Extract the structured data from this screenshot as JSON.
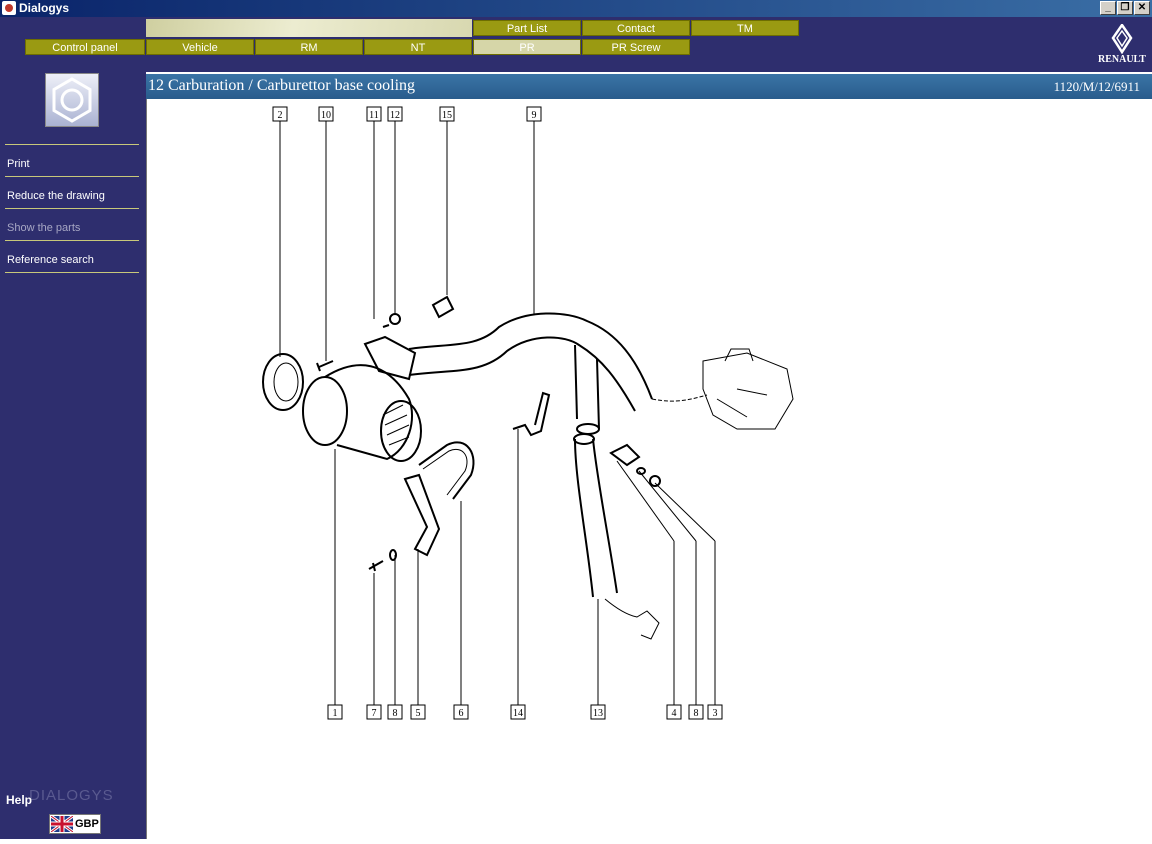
{
  "window": {
    "title": "Dialogys"
  },
  "top_tabs": [
    "Part List",
    "Contact",
    "TM"
  ],
  "nav_tabs": [
    "Control panel",
    "Vehicle",
    "RM",
    "NT",
    "PR",
    "PR Screw"
  ],
  "active_tab": "PR",
  "brand": {
    "name": "RENAULT"
  },
  "sidebar": {
    "items": [
      {
        "label": "Print",
        "enabled": true
      },
      {
        "label": "Reduce the drawing",
        "enabled": true
      },
      {
        "label": "Show the parts",
        "enabled": false
      },
      {
        "label": "Reference search",
        "enabled": true
      }
    ],
    "help": "Help",
    "brand_watermark": "DIALOGYS",
    "currency": "GBP"
  },
  "content": {
    "title": "12 Carburation / Carburettor base cooling",
    "reference": "1120/M/12/6911"
  },
  "diagram": {
    "top_labels": [
      "2",
      "10",
      "11",
      "12",
      "15",
      "9"
    ],
    "bottom_labels": [
      "1",
      "7",
      "8",
      "5",
      "6",
      "14",
      "13",
      "4",
      "8",
      "3"
    ]
  },
  "colors": {
    "sidebar": "#2e2e6e",
    "tab": "#9a9a12",
    "titlebar": "#0a246a",
    "contentbar": "#3a74a6"
  }
}
